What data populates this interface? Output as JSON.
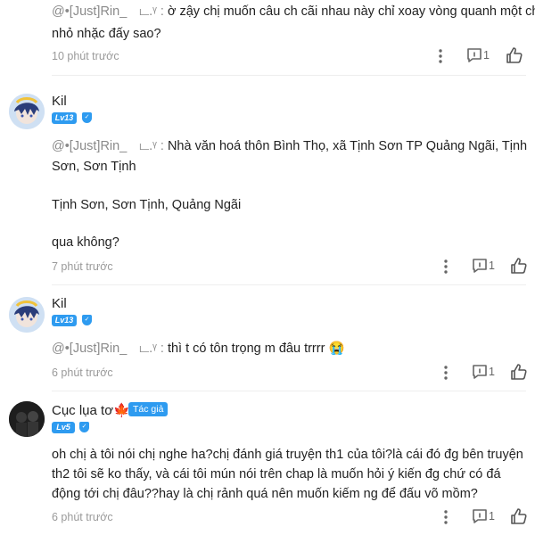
{
  "comments": [
    {
      "mention": "@•[Just]Rin_ㅤட.ᵞ :",
      "lines": [
        "ờ zậy chị muốn câu ch cãi nhau này chỉ xoay vòng quanh một ch",
        "nhỏ nhặc đấy sao?"
      ],
      "time": "10 phút trước",
      "reply_count": "1"
    },
    {
      "author": "Kil",
      "level": "Lv13",
      "mention": "@•[Just]Rin_ㅤட.ᵞ :",
      "lines": [
        "Nhà văn hoá thôn Bình Thọ, xã Tịnh Sơn TP Quảng Ngãi, Tịnh",
        "Sơn, Sơn Tịnh",
        "",
        "Tịnh Sơn, Sơn Tịnh, Quảng Ngãi",
        "",
        "qua không?"
      ],
      "time": "7 phút trước",
      "reply_count": "1"
    },
    {
      "author": "Kil",
      "level": "Lv13",
      "mention": "@•[Just]Rin_ㅤட.ᵞ :",
      "lines": [
        "thì t có tôn trọng m đâu trrrr 😭"
      ],
      "time": "6 phút trước",
      "reply_count": "1"
    },
    {
      "author": "Cục lụa tơ🍁",
      "level": "Lv5",
      "author_tag": "Tác giả",
      "lines": [
        "oh chị à tôi nói chị nghe ha?chị đánh giá truyện th1 của tôi?là cái đó đg bên truyện",
        "th2 tôi sẽ ko thấy, và cái tôi mún nói trên chap là muốn hỏi ý kiến đg chứ có đá",
        "động tới chị đâu??hay là chị rảnh quá nên muốn kiếm ng để đấu võ mồm?"
      ],
      "time": "6 phút trước",
      "reply_count": "1"
    }
  ],
  "icons": {
    "more": "more-vertical-icon",
    "reply": "comment-icon",
    "like": "thumbs-up-icon",
    "shield": "shield-icon"
  },
  "colors": {
    "accent": "#2e9bf0",
    "muted": "#9a9a9a"
  }
}
